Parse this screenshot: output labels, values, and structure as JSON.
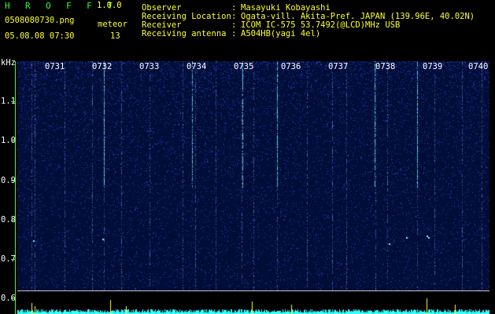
{
  "header": {
    "title": "H R O F F T",
    "version": "1.0.0",
    "file_name": "0508080730.png",
    "datetime": "05.08.08 07:30",
    "meteor_label": "meteor",
    "meteor_count": "13"
  },
  "info": {
    "labels": "Observer\nReceiving Location\nReceiver\nReceiving antenna",
    "colons": ":\n:\n:\n:",
    "values": "Masayuki Kobayashi\nOgata-vill. Akita-Pref. JAPAN (139.96E, 40.02N)\nICOM IC-575 53.7492(@LCD)MHz USB\nA504HB(yagi 4el)"
  },
  "axis": {
    "unit": "kHz",
    "freq_labels": [
      "1.1",
      "1.0",
      "0.9",
      "0.8",
      "0.7",
      "0.6"
    ],
    "time_labels": [
      "0731",
      "0732",
      "0733",
      "0734",
      "0735",
      "0736",
      "0737",
      "0738",
      "0739",
      "0740"
    ]
  },
  "colors": {
    "header_green": "#33ff33",
    "header_yellow": "#ffff33",
    "background": "#000d36",
    "noise": "#2233cc",
    "meteor_trace": "#66ffff",
    "baseline": "#33ffff"
  }
}
